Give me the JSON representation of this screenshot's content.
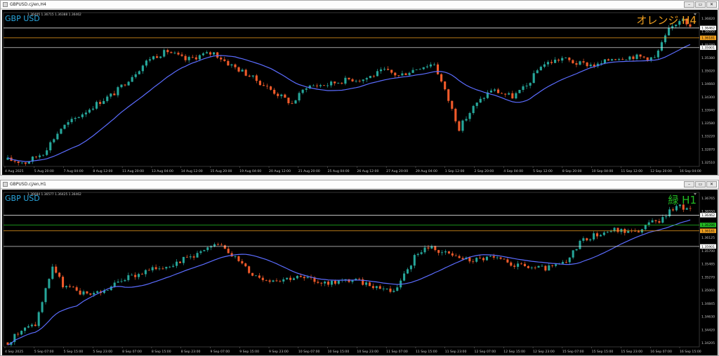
{
  "windows": [
    {
      "title": "GBPUSD.cj/en,H4",
      "buttons": [
        "–",
        "▭",
        "✕"
      ],
      "symbol_label": "GBP USD",
      "ohlc_text": "1.36405 1.36715 1.36388 1.36462",
      "annotation": "オレンジ H4",
      "annotation_color": "#f0a020",
      "price_ticks": [
        "1.36820",
        "1.36050",
        "1.35740",
        "1.35380",
        "1.35020",
        "1.34660",
        "1.34300",
        "1.33940",
        "1.33580",
        "1.33220",
        "1.32870",
        "1.32510"
      ],
      "hlines": [
        {
          "price": 1.36462,
          "label": "1.36462",
          "color": "#ffffff",
          "tag_bg": "#ffffff",
          "tag_fg": "#000000"
        },
        {
          "price": 1.36181,
          "label": "1.36181",
          "color": "#f0a020",
          "tag_bg": "#f0a020",
          "tag_fg": "#000000"
        },
        {
          "price": 1.35901,
          "label": "1.35901",
          "color": "#ffffff",
          "tag_bg": "#ffffff",
          "tag_fg": "#000000"
        }
      ],
      "time_labels": [
        "4 Aug 2025",
        "5 Aug 20:00",
        "7 Aug 04:00",
        "8 Aug 12:00",
        "11 Aug 20:00",
        "13 Aug 04:00",
        "14 Aug 12:00",
        "15 Aug 20:00",
        "19 Aug 04:00",
        "20 Aug 12:00",
        "21 Aug 20:00",
        "25 Aug 04:00",
        "26 Aug 12:00",
        "27 Aug 20:00",
        "29 Aug 04:00",
        "1 Sep 12:00",
        "2 Sep 20:00",
        "4 Sep 04:00",
        "5 Sep 12:00",
        "8 Sep 20:00",
        "10 Sep 04:00",
        "11 Sep 12:00",
        "12 Sep 20:00",
        "16 Sep 04:00"
      ]
    },
    {
      "title": "GBPUSD.cj/en,H1",
      "buttons": [
        "–",
        "▭",
        "✕"
      ],
      "symbol_label": "GBP USD",
      "ohlc_text": "1.36684 1.36577 1.36425 1.36462",
      "annotation": "緑 H1",
      "annotation_color": "#22bb22",
      "price_ticks": [
        "1.36765",
        "1.36550",
        "1.36340",
        "1.36125",
        "1.35700",
        "1.35485",
        "1.35270",
        "1.35060",
        "1.34845",
        "1.34630",
        "1.34420",
        "1.34205"
      ],
      "hlines": [
        {
          "price": 1.36462,
          "label": "1.36462",
          "color": "#ffffff",
          "tag_bg": "#ffffff",
          "tag_fg": "#000000"
        },
        {
          "price": 1.36286,
          "label": "1.36286",
          "color": "#22bb22",
          "tag_bg": "#22bb22",
          "tag_fg": "#000000"
        },
        {
          "price": 1.36181,
          "label": "1.36181",
          "color": "#f0a020",
          "tag_bg": "#f0a020",
          "tag_fg": "#000000"
        },
        {
          "price": 1.35901,
          "label": "1.35901",
          "color": "#ffffff",
          "tag_bg": "#ffffff",
          "tag_fg": "#000000"
        }
      ],
      "time_labels": [
        "4 Sep 2025",
        "5 Sep 07:00",
        "5 Sep 15:00",
        "5 Sep 23:00",
        "8 Sep 07:00",
        "8 Sep 15:00",
        "8 Sep 23:00",
        "9 Sep 07:00",
        "9 Sep 15:00",
        "9 Sep 23:00",
        "10 Sep 07:00",
        "10 Sep 15:00",
        "10 Sep 23:00",
        "11 Sep 07:00",
        "11 Sep 15:00",
        "11 Sep 23:00",
        "12 Sep 07:00",
        "12 Sep 15:00",
        "12 Sep 23:00",
        "15 Sep 07:00",
        "15 Sep 15:00",
        "15 Sep 23:00",
        "16 Sep 07:00",
        "16 Sep 15:00"
      ]
    }
  ],
  "colors": {
    "bull": "#26a69a",
    "bear": "#ef5a2a",
    "ma": "#5b6cff",
    "grid": "#2a2a2a",
    "axis_text": "#c8c8c8",
    "symbol_label": "#2aa8e0"
  },
  "chart_data": [
    {
      "type": "candlestick",
      "timeframe": "H4",
      "ylim": [
        1.3251,
        1.369
      ],
      "anchors": [
        [
          0,
          1.327
        ],
        [
          5,
          1.3262
        ],
        [
          10,
          1.329
        ],
        [
          15,
          1.336
        ],
        [
          20,
          1.3395
        ],
        [
          25,
          1.343
        ],
        [
          30,
          1.346
        ],
        [
          35,
          1.351
        ],
        [
          40,
          1.356
        ],
        [
          45,
          1.358
        ],
        [
          50,
          1.3555
        ],
        [
          55,
          1.357
        ],
        [
          58,
          1.3575
        ],
        [
          62,
          1.3545
        ],
        [
          68,
          1.351
        ],
        [
          74,
          1.347
        ],
        [
          80,
          1.343
        ],
        [
          84,
          1.348
        ],
        [
          90,
          1.3485
        ],
        [
          96,
          1.35
        ],
        [
          100,
          1.35
        ],
        [
          106,
          1.3525
        ],
        [
          110,
          1.351
        ],
        [
          116,
          1.3535
        ],
        [
          120,
          1.3545
        ],
        [
          124,
          1.344
        ],
        [
          127,
          1.336
        ],
        [
          131,
          1.342
        ],
        [
          136,
          1.347
        ],
        [
          142,
          1.345
        ],
        [
          146,
          1.348
        ],
        [
          150,
          1.354
        ],
        [
          156,
          1.356
        ],
        [
          160,
          1.3545
        ],
        [
          166,
          1.354
        ],
        [
          170,
          1.356
        ],
        [
          176,
          1.3565
        ],
        [
          182,
          1.356
        ],
        [
          186,
          1.364
        ],
        [
          190,
          1.368
        ],
        [
          192,
          1.3646
        ]
      ],
      "ma_period": 21
    },
    {
      "type": "candlestick",
      "timeframe": "H1",
      "ylim": [
        1.341,
        1.3687
      ],
      "anchors": [
        [
          0,
          1.3418
        ],
        [
          4,
          1.344
        ],
        [
          8,
          1.345
        ],
        [
          13,
          1.3555
        ],
        [
          16,
          1.352
        ],
        [
          22,
          1.3505
        ],
        [
          28,
          1.351
        ],
        [
          33,
          1.353
        ],
        [
          40,
          1.3545
        ],
        [
          48,
          1.356
        ],
        [
          56,
          1.358
        ],
        [
          62,
          1.3595
        ],
        [
          66,
          1.357
        ],
        [
          71,
          1.354
        ],
        [
          76,
          1.353
        ],
        [
          84,
          1.3535
        ],
        [
          92,
          1.3525
        ],
        [
          100,
          1.353
        ],
        [
          106,
          1.352
        ],
        [
          112,
          1.351
        ],
        [
          118,
          1.357
        ],
        [
          122,
          1.359
        ],
        [
          128,
          1.3575
        ],
        [
          134,
          1.3565
        ],
        [
          140,
          1.357
        ],
        [
          148,
          1.3555
        ],
        [
          156,
          1.355
        ],
        [
          162,
          1.356
        ],
        [
          166,
          1.36
        ],
        [
          170,
          1.361
        ],
        [
          176,
          1.362
        ],
        [
          182,
          1.3615
        ],
        [
          186,
          1.363
        ],
        [
          190,
          1.364
        ],
        [
          194,
          1.3665
        ],
        [
          198,
          1.3654
        ]
      ],
      "ma_period": 21
    }
  ]
}
